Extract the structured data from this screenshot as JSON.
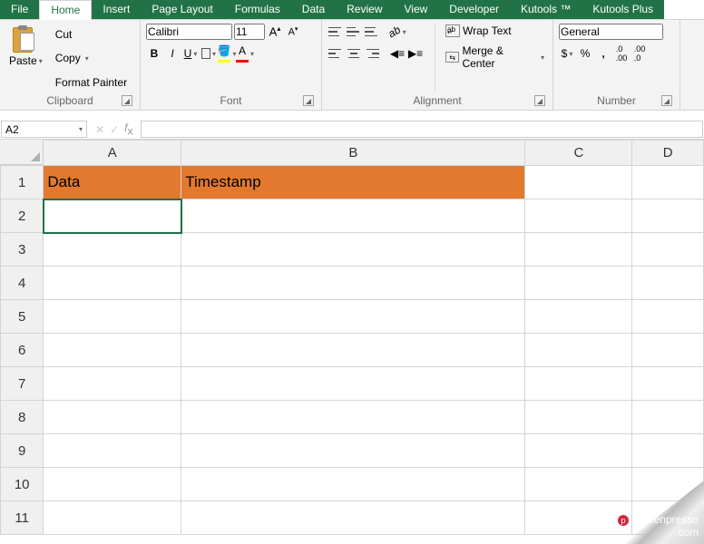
{
  "tabs": [
    "File",
    "Home",
    "Insert",
    "Page Layout",
    "Formulas",
    "Data",
    "Review",
    "View",
    "Developer",
    "Kutools ™",
    "Kutools Plus"
  ],
  "activeTab": "Home",
  "clipboard": {
    "paste": "Paste",
    "cut": "Cut",
    "copy": "Copy",
    "painter": "Format Painter",
    "group": "Clipboard"
  },
  "font": {
    "name": "Calibri",
    "size": "11",
    "group": "Font"
  },
  "alignment": {
    "wrap": "Wrap Text",
    "merge": "Merge & Center",
    "group": "Alignment"
  },
  "number": {
    "format": "General",
    "group": "Number"
  },
  "nameBox": "A2",
  "sheet": {
    "cols": [
      "A",
      "B",
      "C",
      "D"
    ],
    "rows": [
      "1",
      "2",
      "3",
      "4",
      "5",
      "6",
      "7",
      "8",
      "9",
      "10",
      "11"
    ],
    "headers": {
      "A1": "Data",
      "B1": "Timestamp"
    }
  },
  "watermark": {
    "brand": "Screenpresso",
    "suffix": ".com"
  }
}
